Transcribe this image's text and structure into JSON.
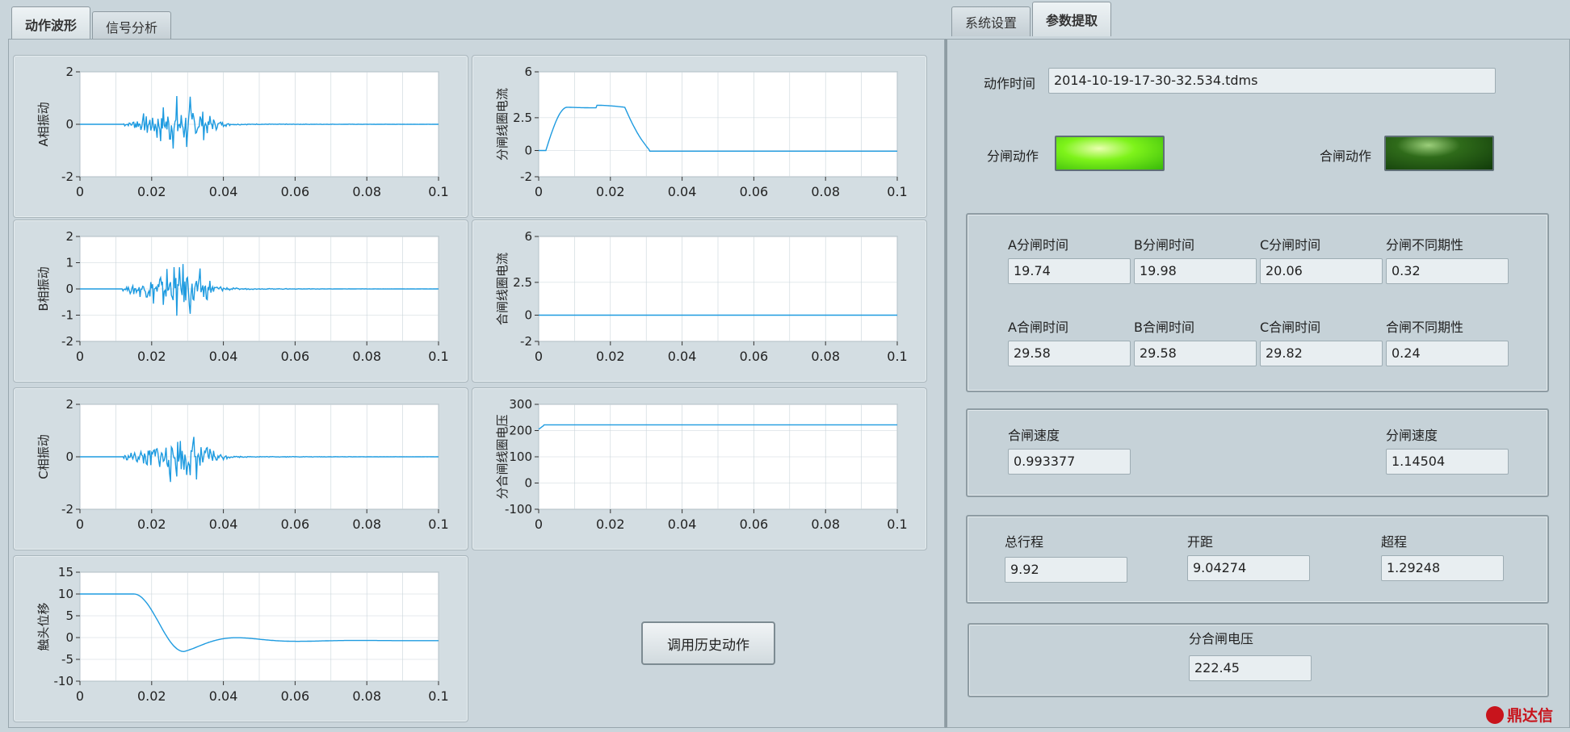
{
  "tabs": {
    "left": [
      {
        "label": "动作波形",
        "active": true
      },
      {
        "label": "信号分析",
        "active": false
      }
    ],
    "right": [
      {
        "label": "系统设置",
        "active": false
      },
      {
        "label": "参数提取",
        "active": true
      }
    ]
  },
  "colors": {
    "trace": "#1e9be0",
    "plot_bg": "#ffffff",
    "grid": "#c9d4da"
  },
  "charts": [
    {
      "id": "a-vibration",
      "ylabel": "A相振动",
      "kind": "vibration",
      "ylim": [
        -2,
        2
      ],
      "yticks": [
        "2",
        "0",
        "-2"
      ],
      "xticks": [
        "0",
        "0.02",
        "0.04",
        "0.06",
        "0.08",
        "0.1"
      ]
    },
    {
      "id": "b-vibration",
      "ylabel": "B相振动",
      "kind": "vibration",
      "ylim": [
        -2,
        2
      ],
      "yticks": [
        "2",
        "1",
        "0",
        "-1",
        "-2"
      ],
      "xticks": [
        "0",
        "0.02",
        "0.04",
        "0.06",
        "0.08",
        "0.1"
      ]
    },
    {
      "id": "c-vibration",
      "ylabel": "C相振动",
      "kind": "vibration",
      "ylim": [
        -2,
        2
      ],
      "yticks": [
        "2",
        "0",
        "-2"
      ],
      "xticks": [
        "0",
        "0.02",
        "0.04",
        "0.06",
        "0.08",
        "0.1"
      ]
    },
    {
      "id": "contact-displacement",
      "ylabel": "触头位移",
      "kind": "displacement",
      "ylim": [
        -10,
        15
      ],
      "yticks": [
        "15",
        "10",
        "5",
        "0",
        "-5",
        "-10"
      ],
      "xticks": [
        "0",
        "0.02",
        "0.04",
        "0.06",
        "0.08",
        "0.1"
      ]
    },
    {
      "id": "open-coil-current",
      "ylabel": "分闸线圈电流",
      "kind": "opencurrent",
      "ylim": [
        -2,
        6
      ],
      "yticks": [
        "6",
        "2.5",
        "0",
        "-2"
      ],
      "xticks": [
        "0",
        "0.02",
        "0.04",
        "0.06",
        "0.08",
        "0.1"
      ]
    },
    {
      "id": "close-coil-current",
      "ylabel": "合闸线圈电流",
      "kind": "flat",
      "ylim": [
        -2,
        6
      ],
      "yticks": [
        "6",
        "2.5",
        "0",
        "-2"
      ],
      "xticks": [
        "0",
        "0.02",
        "0.04",
        "0.06",
        "0.08",
        "0.1"
      ]
    },
    {
      "id": "coil-voltage",
      "ylabel": "分合闸线圈电压",
      "kind": "voltage",
      "ylim": [
        -100,
        300
      ],
      "yticks": [
        "300",
        "200",
        "100",
        "0",
        "-100"
      ],
      "xticks": [
        "0",
        "0.02",
        "0.04",
        "0.06",
        "0.08",
        "0.1"
      ]
    }
  ],
  "history_button": "调用历史动作",
  "params": {
    "action_time_label": "动作时间",
    "action_time_value": "2014-10-19-17-30-32.534.tdms",
    "open_action_label": "分闸动作",
    "close_action_label": "合闸动作",
    "open_action_on": true,
    "close_action_on": false,
    "open_times": {
      "labels": [
        "A分闸时间",
        "B分闸时间",
        "C分闸时间",
        "分闸不同期性"
      ],
      "values": [
        "19.74",
        "19.98",
        "20.06",
        "0.32"
      ]
    },
    "close_times": {
      "labels": [
        "A合闸时间",
        "B合闸时间",
        "C合闸时间",
        "合闸不同期性"
      ],
      "values": [
        "29.58",
        "29.58",
        "29.82",
        "0.24"
      ]
    },
    "speed": {
      "close_label": "合闸速度",
      "close_value": "0.993377",
      "open_label": "分闸速度",
      "open_value": "1.14504"
    },
    "travel": {
      "total_label": "总行程",
      "total_value": "9.92",
      "gap_label": "开距",
      "gap_value": "9.04274",
      "over_label": "超程",
      "over_value": "1.29248"
    },
    "voltage": {
      "label": "分合闸电压",
      "value": "222.45"
    }
  },
  "watermark": "鼎达信"
}
